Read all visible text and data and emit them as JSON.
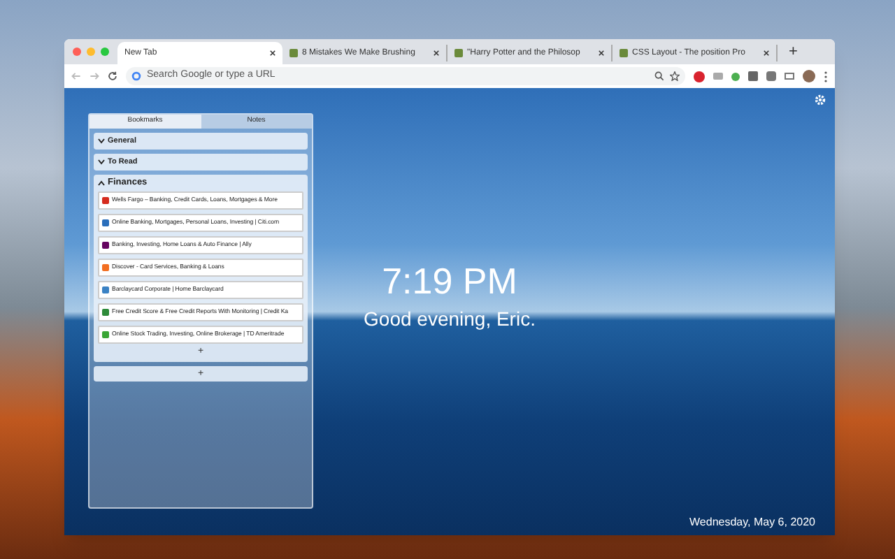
{
  "tabs": [
    {
      "title": "New Tab",
      "selected": true
    },
    {
      "title": "8 Mistakes We Make Brushing",
      "selected": false
    },
    {
      "title": "\"Harry Potter and the Philosop",
      "selected": false
    },
    {
      "title": "CSS Layout - The position Pro",
      "selected": false
    }
  ],
  "new_tab": "+",
  "omnibox": {
    "placeholder": "Search Google or type a URL"
  },
  "panel": {
    "tabs": [
      {
        "label": "Bookmarks",
        "selected": true
      },
      {
        "label": "Notes",
        "selected": false
      }
    ],
    "folders": [
      {
        "name": "General",
        "expanded": false
      },
      {
        "name": "To Read",
        "expanded": false
      },
      {
        "name": "Finances",
        "expanded": true,
        "items": [
          {
            "title": "Wells Fargo – Banking, Credit Cards, Loans, Mortgages & More",
            "color": "#d52b1e"
          },
          {
            "title": "Online Banking, Mortgages, Personal Loans, Investing | Citi.com",
            "color": "#2a6ebb"
          },
          {
            "title": "Banking, Investing, Home Loans & Auto Finance | Ally",
            "color": "#650360"
          },
          {
            "title": "Discover - Card Services, Banking & Loans",
            "color": "#f26e21"
          },
          {
            "title": "Barclaycard Corporate | Home Barclaycard",
            "color": "#3b82c4"
          },
          {
            "title": "Free Credit Score & Free Credit Reports With Monitoring | Credit Ka",
            "color": "#2e8b3a"
          },
          {
            "title": "Online Stock Trading, Investing, Online Brokerage | TD Ameritrade",
            "color": "#3aa635"
          }
        ]
      }
    ],
    "add_bookmark": "+",
    "add_folder": "+"
  },
  "clock": "7:19 PM",
  "greeting": "Good evening, Eric.",
  "date": "Wednesday, May 6, 2020"
}
